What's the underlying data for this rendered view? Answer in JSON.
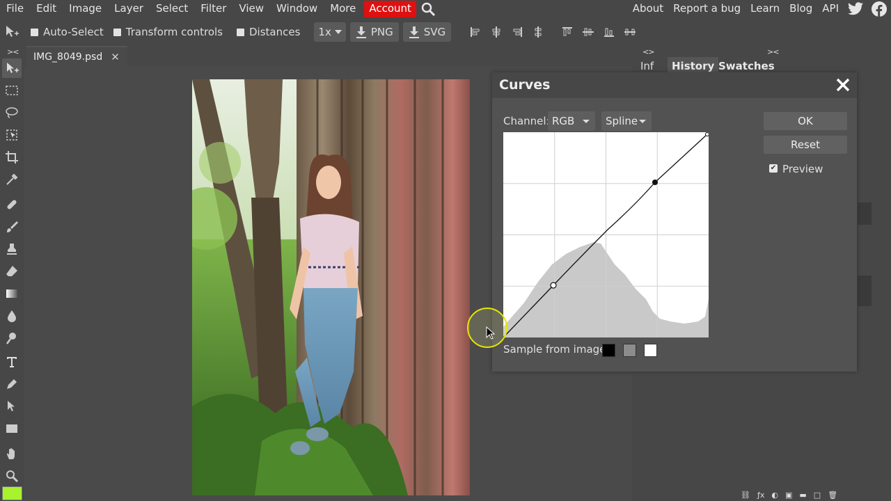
{
  "menubar": {
    "items": [
      "File",
      "Edit",
      "Image",
      "Layer",
      "Select",
      "Filter",
      "View",
      "Window",
      "More"
    ],
    "account": "Account",
    "right": [
      "About",
      "Report a bug",
      "Learn",
      "Blog",
      "API"
    ],
    "accent_color": "#dd1111"
  },
  "options": {
    "auto_select": "Auto-Select",
    "transform_controls": "Transform controls",
    "distances": "Distances",
    "zoom": "1x",
    "png": "PNG",
    "svg": "SVG"
  },
  "tools": {
    "collapse": "><",
    "foreground_color": "#a7f32e"
  },
  "document": {
    "tab_name": "IMG_8049.psd",
    "close_glyph": "✕"
  },
  "panels": {
    "left_arrows": "<>",
    "right_arrows": "><",
    "info_tab": "Inf",
    "history_tab": "History",
    "swatches_tab": "Swatches"
  },
  "curves": {
    "title": "Curves",
    "channel_label": "Channel:",
    "channel_value": "RGB",
    "mode_value": "Spline",
    "ok": "OK",
    "reset": "Reset",
    "preview_label": "Preview",
    "preview_checked": true,
    "sample_label": "Sample from image:",
    "sample_colors": [
      "#000000",
      "#8c8c8c",
      "#ffffff"
    ]
  }
}
